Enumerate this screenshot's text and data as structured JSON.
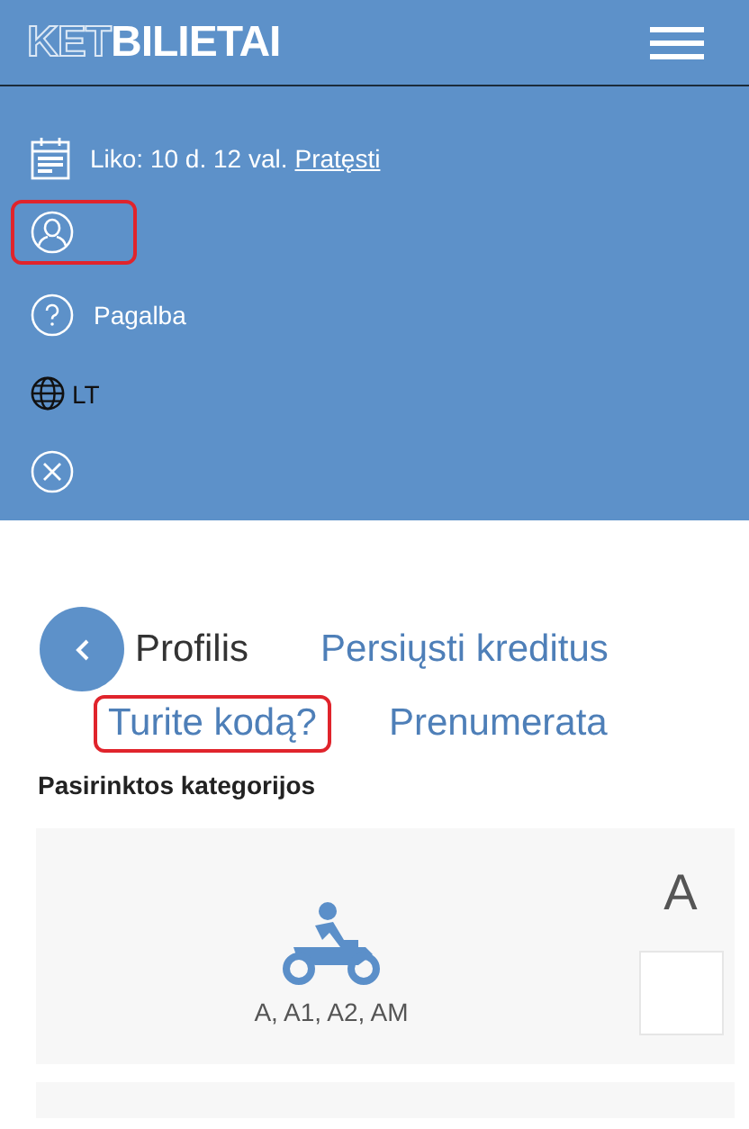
{
  "header": {
    "logo": {
      "outlined": "KET",
      "bold": "BILIETAI"
    }
  },
  "menu": [
    {
      "kind": "calendar",
      "text": "Liko: 10 d. 12 val.",
      "link": "Pratęsti",
      "highlighted": false
    },
    {
      "kind": "user",
      "highlighted": true
    },
    {
      "kind": "help",
      "text": "Pagalba",
      "highlighted": false
    },
    {
      "kind": "language",
      "text": "LT",
      "highlighted": false
    },
    {
      "kind": "close",
      "highlighted": false
    }
  ],
  "tabs": [
    {
      "label": "Profilis",
      "selected": true,
      "highlighted": false
    },
    {
      "label": "Persiųsti kreditus",
      "selected": false,
      "highlighted": false
    },
    {
      "label": "Turite kodą?",
      "selected": false,
      "highlighted": true
    },
    {
      "label": "Prenumerata",
      "selected": false,
      "highlighted": false
    }
  ],
  "section_title": "Pasirinktos kategorijos",
  "categories": [
    {
      "letter": "A",
      "subtitle": "A, A1, A2, AM",
      "checked": false
    }
  ]
}
